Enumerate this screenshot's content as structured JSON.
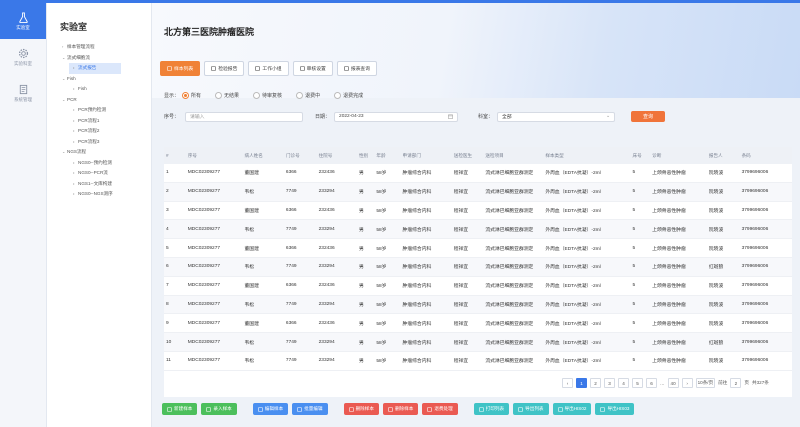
{
  "rail": [
    {
      "label": "实验室",
      "icon": "flask-icon",
      "active": true
    },
    {
      "label": "实验科室",
      "icon": "gear-icon",
      "active": false
    },
    {
      "label": "系统管理",
      "icon": "document-icon",
      "active": false
    }
  ],
  "tree": {
    "title": "实验室",
    "nodes": [
      {
        "label": "样本管理流程",
        "level": 1,
        "arrow": "›"
      },
      {
        "label": "流式细胞流",
        "level": 1,
        "arrow": "⌄"
      },
      {
        "label": "流式报告",
        "level": 2,
        "selected": true
      },
      {
        "label": "Fish",
        "level": 1,
        "arrow": "⌄"
      },
      {
        "label": "Fish",
        "level": 2
      },
      {
        "label": "PCR",
        "level": 1,
        "arrow": "⌄"
      },
      {
        "label": "PCR预约检测",
        "level": 2
      },
      {
        "label": "PCR流程1",
        "level": 2
      },
      {
        "label": "PCR流程2",
        "level": 2
      },
      {
        "label": "PCR流程3",
        "level": 2
      },
      {
        "label": "NGS流程",
        "level": 1,
        "arrow": "⌄"
      },
      {
        "label": "NGS0--预约检测",
        "level": 2
      },
      {
        "label": "NGS0--PCR流",
        "level": 2
      },
      {
        "label": "NGS1--文库构建",
        "level": 2
      },
      {
        "label": "NGS0--NGS测序",
        "level": 2
      }
    ]
  },
  "header": {
    "hospital": "北方第三医院肿瘤医院"
  },
  "toolbar": [
    {
      "label": "样本列表",
      "active": true,
      "icon": "list-icon"
    },
    {
      "label": "检验报告",
      "active": false,
      "icon": "report-icon"
    },
    {
      "label": "工作小组",
      "active": false,
      "icon": "group-icon"
    },
    {
      "label": "审核设置",
      "active": false,
      "icon": "settings-icon"
    },
    {
      "label": "报表查询",
      "active": false,
      "icon": "chart-icon"
    }
  ],
  "filter": {
    "show_label": "显示：",
    "status_options": [
      {
        "label": "所有",
        "selected": true
      },
      {
        "label": "无结果",
        "selected": false
      },
      {
        "label": "待审复核",
        "selected": false
      },
      {
        "label": "退费中",
        "selected": false
      },
      {
        "label": "退费完成",
        "selected": false
      }
    ],
    "seq_label": "序号：",
    "seq_placeholder": "请输入",
    "date_label": "日期：",
    "date_value": "2022-04-23",
    "dept_label": "科室：",
    "dept_value": "全部",
    "query_label": "查询"
  },
  "table": {
    "columns": [
      "#",
      "序号",
      "病人姓名",
      "门诊号",
      "住院号",
      "性别",
      "年龄",
      "申请部门",
      "送检医生",
      "送检项目",
      "样本类型",
      "床号",
      "诊断",
      "报告人",
      "条码"
    ],
    "rows": [
      [
        "1",
        "MDC02309277",
        "董国建",
        "6366",
        "232436",
        "男",
        "58岁",
        "肿瘤综合内科",
        "程祥宜",
        "流式淋巴细胞亚群测定",
        "外周血（EDTA抗凝）-2ml",
        "5",
        "上颌骨恶性肿瘤",
        "阮晓波",
        "3799696006"
      ],
      [
        "2",
        "MDC02309277",
        "韦松",
        "7749",
        "233294",
        "男",
        "58岁",
        "肿瘤综合内科",
        "程祥宜",
        "流式淋巴细胞亚群测定",
        "外周血（EDTA抗凝）-2ml",
        "5",
        "上颌骨恶性肿瘤",
        "阮晓波",
        "3799696006"
      ],
      [
        "3",
        "MDC02309277",
        "董国建",
        "6366",
        "232436",
        "男",
        "58岁",
        "肿瘤综合内科",
        "程祥宜",
        "流式淋巴细胞亚群测定",
        "外周血（EDTA抗凝）-2ml",
        "5",
        "上颌骨恶性肿瘤",
        "阮晓波",
        "3799696006"
      ],
      [
        "4",
        "MDC02309277",
        "韦松",
        "7749",
        "233294",
        "男",
        "58岁",
        "肿瘤综合内科",
        "程祥宜",
        "流式淋巴细胞亚群测定",
        "外周血（EDTA抗凝）-2ml",
        "5",
        "上颌骨恶性肿瘤",
        "阮晓波",
        "3799696006"
      ],
      [
        "5",
        "MDC02309277",
        "董国建",
        "6366",
        "232436",
        "男",
        "58岁",
        "肿瘤综合内科",
        "程祥宜",
        "流式淋巴细胞亚群测定",
        "外周血（EDTA抗凝）-2ml",
        "5",
        "上颌骨恶性肿瘤",
        "阮晓波",
        "3799696006"
      ],
      [
        "6",
        "MDC02309277",
        "韦松",
        "7749",
        "233294",
        "男",
        "58岁",
        "肿瘤综合内科",
        "程祥宜",
        "流式淋巴细胞亚群测定",
        "外周血（EDTA抗凝）-2ml",
        "5",
        "上颌骨恶性肿瘤",
        "红斑狼",
        "3799696006"
      ],
      [
        "7",
        "MDC02309277",
        "董国建",
        "6366",
        "232436",
        "男",
        "58岁",
        "肿瘤综合内科",
        "程祥宜",
        "流式淋巴细胞亚群测定",
        "外周血（EDTA抗凝）-2ml",
        "5",
        "上颌骨恶性肿瘤",
        "阮晓波",
        "3799696006"
      ],
      [
        "8",
        "MDC02309277",
        "韦松",
        "7749",
        "233294",
        "男",
        "58岁",
        "肿瘤综合内科",
        "程祥宜",
        "流式淋巴细胞亚群测定",
        "外周血（EDTA抗凝）-2ml",
        "5",
        "上颌骨恶性肿瘤",
        "阮晓波",
        "3799696006"
      ],
      [
        "9",
        "MDC02309277",
        "董国建",
        "6366",
        "232436",
        "男",
        "58岁",
        "肿瘤综合内科",
        "程祥宜",
        "流式淋巴细胞亚群测定",
        "外周血（EDTA抗凝）-2ml",
        "5",
        "上颌骨恶性肿瘤",
        "阮晓波",
        "3799696006"
      ],
      [
        "10",
        "MDC02309277",
        "韦松",
        "7749",
        "233294",
        "男",
        "58岁",
        "肿瘤综合内科",
        "程祥宜",
        "流式淋巴细胞亚群测定",
        "外周血（EDTA抗凝）-2ml",
        "5",
        "上颌骨恶性肿瘤",
        "红斑狼",
        "3799696006"
      ],
      [
        "11",
        "MDC02309277",
        "韦松",
        "7749",
        "233294",
        "男",
        "58岁",
        "肿瘤综合内科",
        "程祥宜",
        "流式淋巴细胞亚群测定",
        "外周血（EDTA抗凝）-2ml",
        "5",
        "上颌骨恶性肿瘤",
        "阮晓波",
        "3799696006"
      ]
    ]
  },
  "pagination": {
    "prev": "‹",
    "pages": [
      "1",
      "2",
      "3",
      "4",
      "5",
      "6"
    ],
    "ellipsis": "…",
    "last": "40",
    "next": "›",
    "page_size": "10条/页",
    "goto_label": "前往",
    "goto_value": "2",
    "page_unit": "页",
    "total": "共327条"
  },
  "actions": [
    {
      "label": "新建样本",
      "color": "green",
      "icon": "plus-icon"
    },
    {
      "label": "录入样本",
      "color": "green",
      "icon": "edit-icon"
    },
    {
      "label": "编辑样本",
      "color": "blue",
      "icon": "pencil-icon"
    },
    {
      "label": "批量编辑",
      "color": "blue",
      "icon": "batch-icon"
    },
    {
      "label": "删除样本",
      "color": "red",
      "icon": "trash-icon"
    },
    {
      "label": "删除样本",
      "color": "red",
      "icon": "trash-icon"
    },
    {
      "label": "退费处理",
      "color": "red",
      "icon": "refund-icon"
    },
    {
      "label": "打印列表",
      "color": "teal",
      "icon": "print-icon"
    },
    {
      "label": "导出列表",
      "color": "teal",
      "icon": "export-icon"
    },
    {
      "label": "导出HIS02",
      "color": "teal",
      "icon": "export-icon"
    },
    {
      "label": "导出HIS03",
      "color": "teal",
      "icon": "export-icon"
    }
  ],
  "colors": {
    "accent": "#3a78e8",
    "orange": "#f08237",
    "green": "#4cbf5c",
    "blue": "#4a8ff0",
    "red": "#ea5a52",
    "teal": "#3fc3c6"
  }
}
